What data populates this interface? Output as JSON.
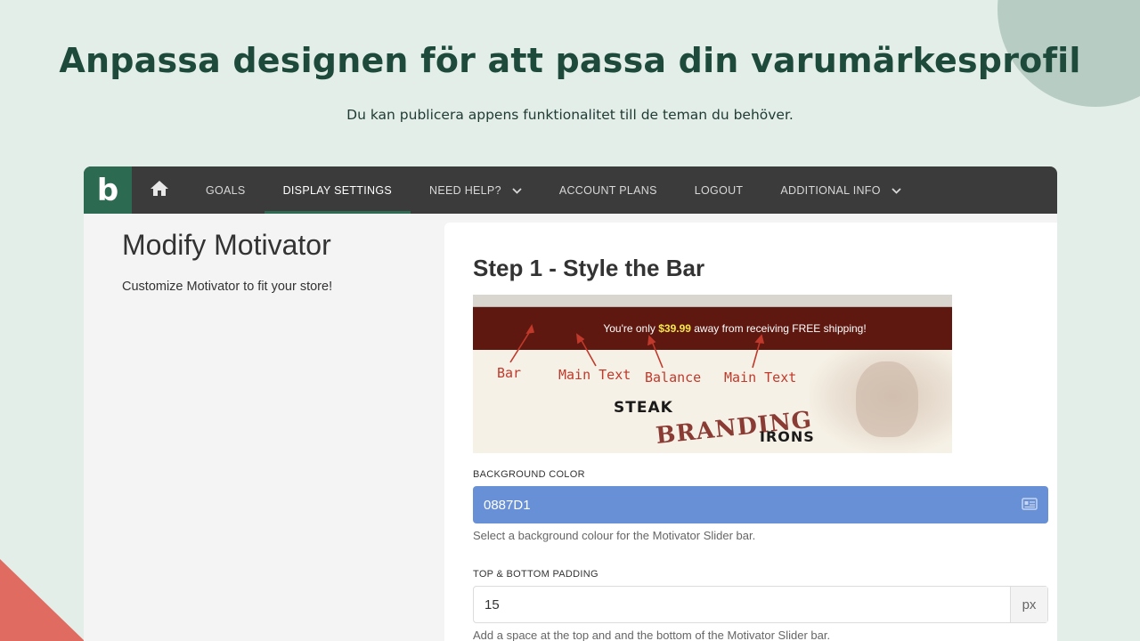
{
  "hero": {
    "title": "Anpassa designen för att passa din varumärkesprofil",
    "subtitle": "Du kan publicera appens funktionalitet till de teman du behöver."
  },
  "navbar": {
    "logo": "b",
    "home_icon": "home-icon",
    "items": [
      {
        "label": "GOALS",
        "active": false,
        "dropdown": false
      },
      {
        "label": "DISPLAY SETTINGS",
        "active": true,
        "dropdown": false
      },
      {
        "label": "NEED HELP?",
        "active": false,
        "dropdown": true
      },
      {
        "label": "ACCOUNT PLANS",
        "active": false,
        "dropdown": false
      },
      {
        "label": "LOGOUT",
        "active": false,
        "dropdown": false
      },
      {
        "label": "ADDITIONAL INFO",
        "active": false,
        "dropdown": true
      }
    ]
  },
  "left": {
    "title": "Modify Motivator",
    "subtitle": "Customize Motivator to fit your store!"
  },
  "panel": {
    "step_title": "Step 1 - Style the Bar",
    "preview": {
      "bar_text_before": "You're only ",
      "bar_balance": "$39.99",
      "bar_text_after": " away from receiving FREE shipping!",
      "labels": [
        "Bar",
        "Main Text",
        "Balance",
        "Main Text"
      ],
      "brand_line1": "STEAK",
      "brand_line2": "BRANDING",
      "brand_line3": "IRONS"
    },
    "background_color": {
      "label": "BACKGROUND COLOR",
      "value": "0887D1",
      "help": "Select a background colour for the Motivator Slider bar."
    },
    "padding": {
      "label": "TOP & BOTTOM PADDING",
      "value": "15",
      "unit": "px",
      "help": "Add a space at the top and and the bottom of the Motivator Slider bar."
    }
  },
  "colors": {
    "brand_green": "#2c6b52",
    "navbar": "#3b3b3b",
    "input_blue": "#6890d6",
    "accent_coral": "#e06b60"
  }
}
